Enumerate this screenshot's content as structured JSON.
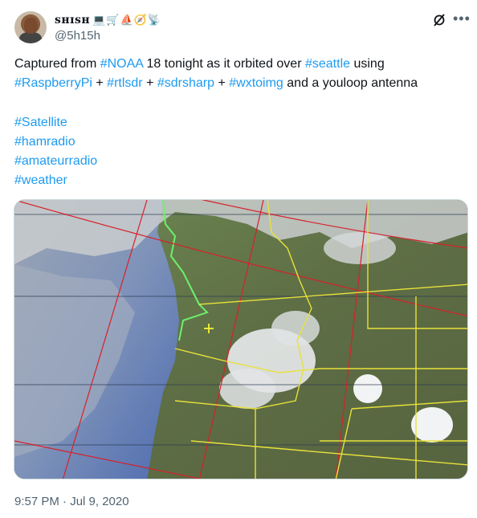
{
  "user": {
    "display_name": "ꜱʜɪꜱʜ",
    "emojis": "💻🛒⛵🧭📡",
    "handle": "@5h15h"
  },
  "tweet": {
    "intro": "Captured from ",
    "noaa": "#NOAA",
    "mid1": " 18 tonight as it orbited over ",
    "seattle": "#seattle",
    "mid2": " using",
    "rpi": "#RaspberryPi",
    "plus1": " + ",
    "rtlsdr": "#rtlsdr",
    "plus2": " + ",
    "sdrsharp": "#sdrsharp",
    "plus3": " + ",
    "wxtoimg": "#wxtoimg",
    "outro": " and a youloop antenna",
    "hashtags": [
      "#Satellite",
      "#hamradio",
      "#amateurradio",
      "#weather"
    ]
  },
  "media": {
    "description_icon": "satellite-weather-image"
  },
  "timestamp": "9:57 PM · Jul 9, 2020",
  "colors": {
    "link": "#1d9bf0",
    "secondary_text": "#536471"
  }
}
